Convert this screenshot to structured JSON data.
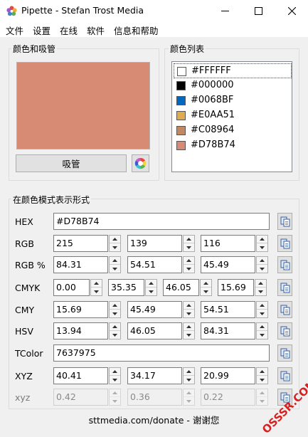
{
  "window": {
    "title": "Pipette - Stefan Trost Media",
    "icon": "pipette-flower-icon",
    "controls": [
      "minimize-icon",
      "maximize-icon",
      "close-icon"
    ]
  },
  "menu": [
    "文件",
    "设置",
    "在线",
    "软件",
    "信息和帮助"
  ],
  "picker": {
    "label": "颜色和吸管",
    "current_color": "#D78B74",
    "eyedropper_button": "吸管",
    "color_wheel_icon": "color-wheel-icon"
  },
  "color_list": {
    "label": "颜色列表",
    "items": [
      {
        "text": "#FFFFFF",
        "color": "#FFFFFF",
        "selected": true
      },
      {
        "text": "#000000",
        "color": "#000000",
        "selected": false
      },
      {
        "text": "#0068BF",
        "color": "#0068BF",
        "selected": false
      },
      {
        "text": "#E0AA51",
        "color": "#E0AA51",
        "selected": false
      },
      {
        "text": "#C08964",
        "color": "#C08964",
        "selected": false
      },
      {
        "text": "#D78B74",
        "color": "#D78B74",
        "selected": false
      }
    ]
  },
  "modes": {
    "label": "在颜色模式表示形式",
    "rows": {
      "hex": {
        "label": "HEX",
        "value": "#D78B74"
      },
      "rgb": {
        "label": "RGB",
        "values": [
          "215",
          "139",
          "116"
        ]
      },
      "rgbp": {
        "label": "RGB %",
        "values": [
          "84.31",
          "54.51",
          "45.49"
        ]
      },
      "cmyk": {
        "label": "CMYK",
        "values": [
          "0.00",
          "35.35",
          "46.05",
          "15.69"
        ]
      },
      "cmy": {
        "label": "CMY",
        "values": [
          "15.69",
          "45.49",
          "54.51"
        ]
      },
      "hsv": {
        "label": "HSV",
        "values": [
          "13.94",
          "46.05",
          "84.31"
        ]
      },
      "tcolor": {
        "label": "TColor",
        "value": "7637975"
      },
      "xyz": {
        "label": "XYZ",
        "values": [
          "40.41",
          "34.17",
          "20.99"
        ]
      },
      "xyz_lower": {
        "label": "xyz",
        "values": [
          "0.42",
          "0.36",
          "0.22"
        ],
        "disabled": true
      }
    }
  },
  "footer": {
    "link": "sttmedia.com/donate - 谢谢您"
  },
  "watermark": "OSSSR.COM"
}
